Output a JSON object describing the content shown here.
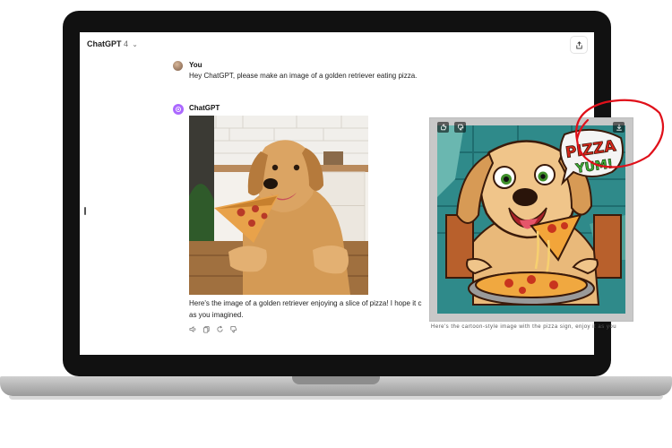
{
  "app": {
    "model_name": "ChatGPT",
    "model_version": "4"
  },
  "conversation": {
    "user": {
      "name": "You",
      "message": "Hey ChatGPT, please make an image of a golden retriever eating pizza."
    },
    "assistant": {
      "name": "ChatGPT",
      "reply_line1": "Here's the image of a golden retriever enjoying a slice of pizza! I hope it c",
      "reply_line2": "as you imagined.",
      "image_subject": "golden retriever eating pizza"
    }
  },
  "cartoon_overlay": {
    "sign_line1": "PIZZA",
    "sign_line2": "YUM!",
    "caption_fragment": "Here's the cartoon-style image with the pizza sign, enjoy it as you"
  },
  "icons": {
    "share": "share-icon",
    "speaker": "speaker-icon",
    "copy": "copy-icon",
    "regenerate": "regenerate-icon",
    "thumbs_down": "thumbs-down-icon"
  },
  "colors": {
    "gpt_accent": "#ab68ff",
    "annotation_red": "#e0101a"
  }
}
